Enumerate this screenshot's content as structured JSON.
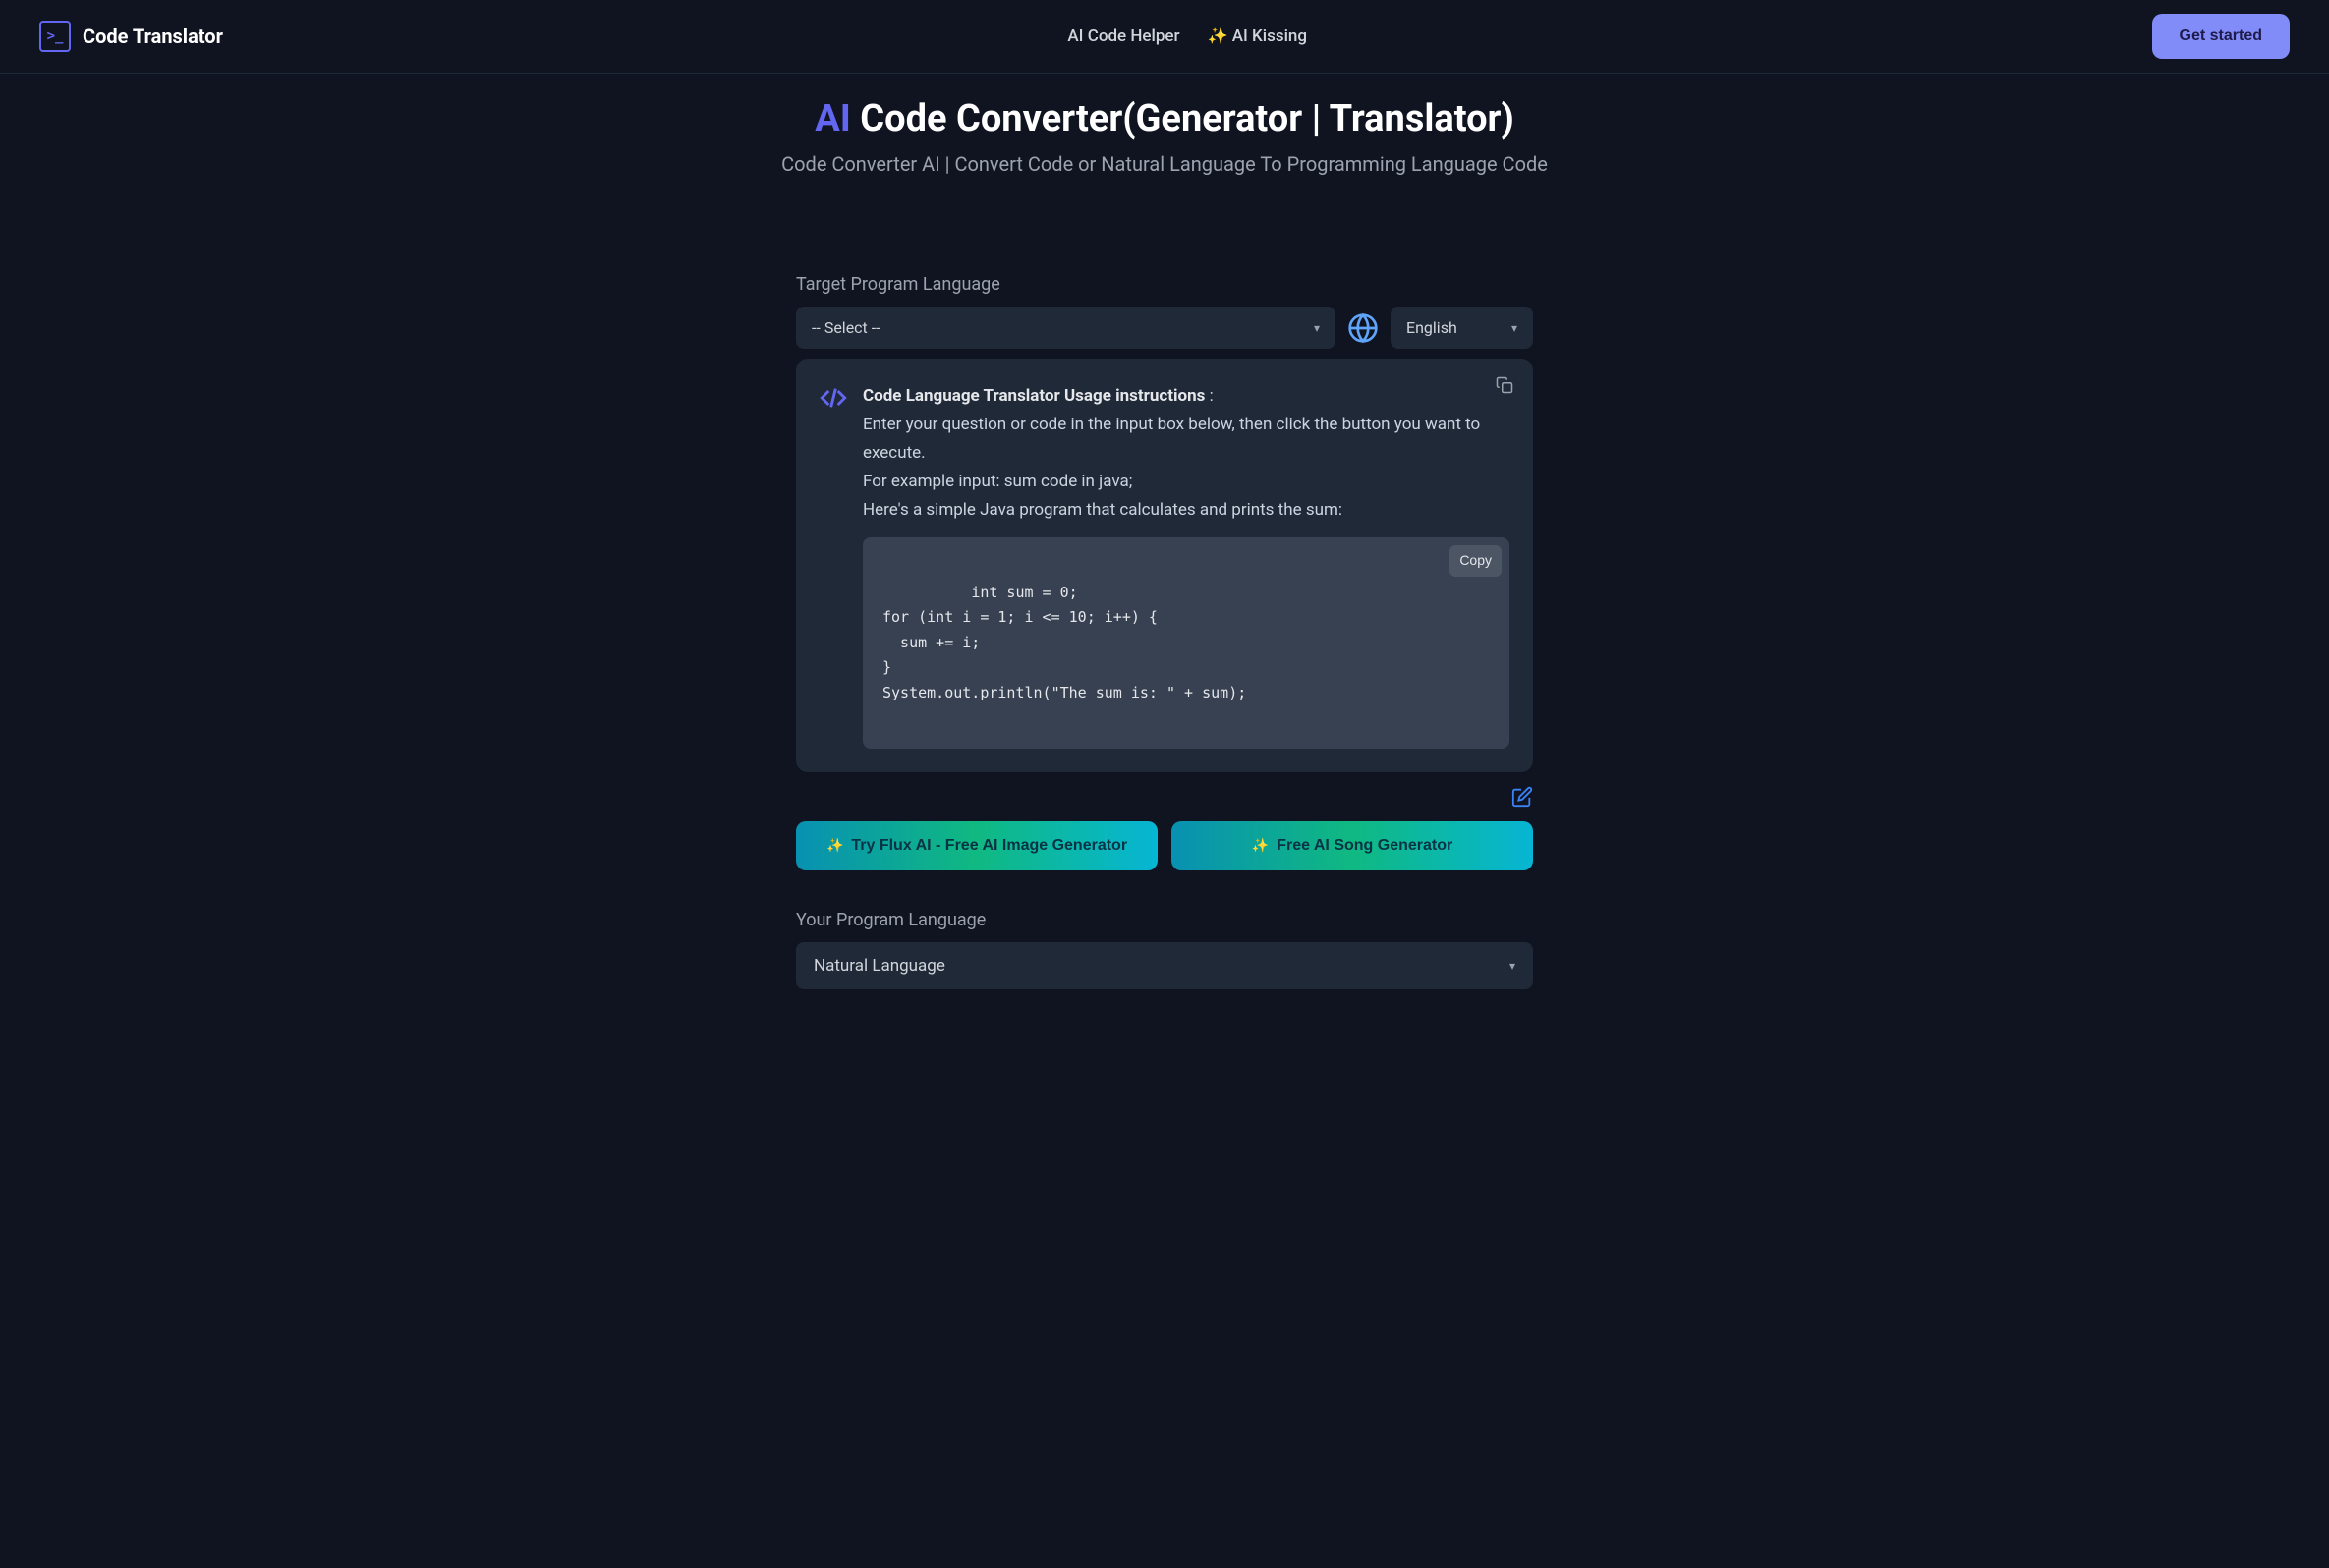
{
  "header": {
    "brand": "Code Translator",
    "nav": {
      "helper": "AI Code Helper",
      "kissing": "AI Kissing"
    },
    "cta": "Get started"
  },
  "hero": {
    "title_prefix": "AI",
    "title_rest": " Code Converter(Generator | Translator)",
    "subtitle": "Code Converter AI | Convert Code or Natural Language To Programming Language Code"
  },
  "target": {
    "label": "Target Program Language",
    "select_placeholder": "-- Select --",
    "lang_value": "English"
  },
  "instructions": {
    "title": "Code Language Translator Usage instructions",
    "colon": " :",
    "line1": "Enter your question or code in the input box below, then click the button you want to execute.",
    "line2": "For example input: sum code in java;",
    "line3": "Here's a simple Java program that calculates and prints the sum:",
    "code": "int sum = 0;\nfor (int i = 1; i <= 10; i++) {\n  sum += i;\n}\nSystem.out.println(\"The sum is: \" + sum);",
    "copy_label": "Copy"
  },
  "promos": {
    "flux": "Try Flux AI - Free AI Image Generator",
    "song": "Free AI Song Generator"
  },
  "your_lang": {
    "label": "Your Program Language",
    "value": "Natural Language"
  }
}
